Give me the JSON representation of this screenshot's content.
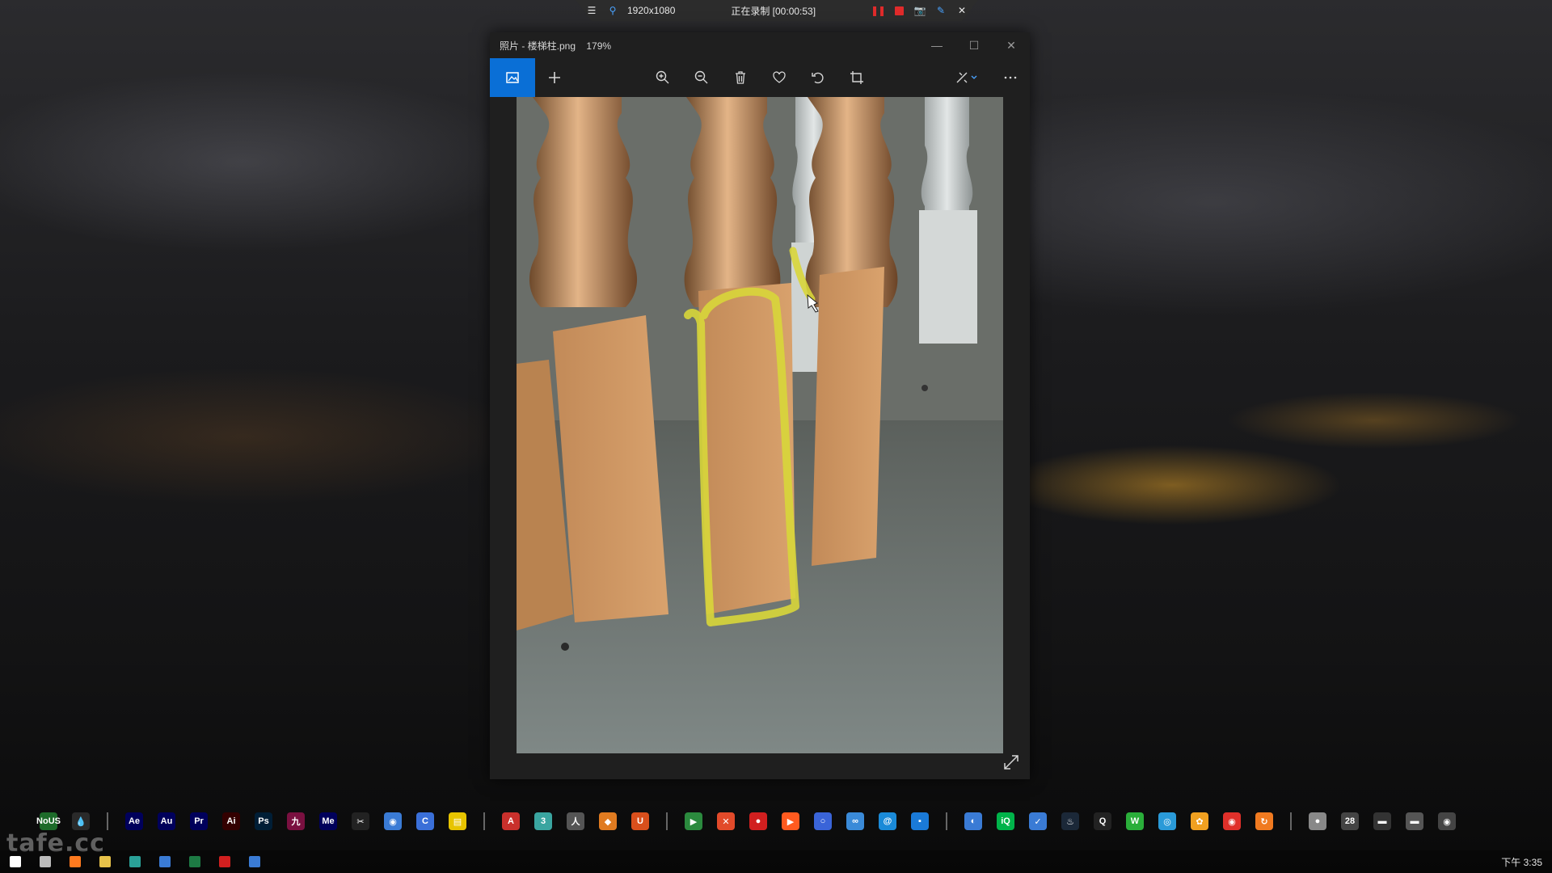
{
  "recording_bar": {
    "resolution": "1920x1080",
    "status": "正在录制 [00:00:53]"
  },
  "photos_window": {
    "title": "照片 - 楼梯柱.png",
    "zoom": "179%"
  },
  "toolbar": {
    "icons": [
      "image-icon",
      "add-icon",
      "zoom-in-icon",
      "zoom-out-icon",
      "delete-icon",
      "favorite-icon",
      "rotate-icon",
      "crop-icon",
      "edit-icon",
      "more-icon"
    ]
  },
  "dock": {
    "groups": [
      [
        {
          "label": "NoUS",
          "color": "#1d6b2a"
        },
        {
          "label": "💧",
          "color": "#2a2a2a"
        }
      ],
      [
        {
          "label": "Ae",
          "color": "#00005b"
        },
        {
          "label": "Au",
          "color": "#00005b"
        },
        {
          "label": "Pr",
          "color": "#00005b"
        },
        {
          "label": "Ai",
          "color": "#330000"
        },
        {
          "label": "Ps",
          "color": "#001e36"
        },
        {
          "label": "九",
          "color": "#7a1040"
        },
        {
          "label": "Me",
          "color": "#00005b"
        },
        {
          "label": "✂",
          "color": "#222222"
        },
        {
          "label": "◉",
          "color": "#3a7bd5"
        },
        {
          "label": "C",
          "color": "#3a6fd8"
        },
        {
          "label": "▤",
          "color": "#e7c400"
        }
      ],
      [
        {
          "label": "A",
          "color": "#c9302c"
        },
        {
          "label": "3",
          "color": "#3aa5a0"
        },
        {
          "label": "人",
          "color": "#555555"
        },
        {
          "label": "◆",
          "color": "#e07b20"
        },
        {
          "label": "U",
          "color": "#d94f1c"
        }
      ],
      [
        {
          "label": "▶",
          "color": "#2b8a3e"
        },
        {
          "label": "✕",
          "color": "#e24a2a"
        },
        {
          "label": "●",
          "color": "#d11f1f"
        },
        {
          "label": "▶",
          "color": "#ff5a1f"
        },
        {
          "label": "○",
          "color": "#3a64d8"
        },
        {
          "label": "∞",
          "color": "#3a8ad8"
        },
        {
          "label": "@",
          "color": "#1a8ad8"
        },
        {
          "label": "▪",
          "color": "#1a7ad8"
        }
      ],
      [
        {
          "label": "◐",
          "color": "#3a7bd5"
        },
        {
          "label": "iQ",
          "color": "#00b34a"
        },
        {
          "label": "✓",
          "color": "#3a7bd5"
        },
        {
          "label": "♨",
          "color": "#1b2838"
        },
        {
          "label": "Q",
          "color": "#222222"
        },
        {
          "label": "W",
          "color": "#2aae3a"
        },
        {
          "label": "◎",
          "color": "#2a9ad8"
        },
        {
          "label": "✿",
          "color": "#f0a020"
        },
        {
          "label": "◉",
          "color": "#e0302a"
        },
        {
          "label": "↻",
          "color": "#f07a20"
        }
      ],
      [
        {
          "label": "●",
          "color": "#888888"
        },
        {
          "label": "28",
          "color": "#444444"
        },
        {
          "label": "▬",
          "color": "#333333"
        },
        {
          "label": "▬",
          "color": "#555555"
        },
        {
          "label": "◉",
          "color": "#444444"
        }
      ]
    ]
  },
  "taskbar": {
    "items": [
      {
        "name": "windows-start-icon",
        "color": "#ffffff"
      },
      {
        "name": "task-view-icon",
        "color": "#bbbbbb"
      },
      {
        "name": "firefox-icon",
        "color": "#ff7a1f"
      },
      {
        "name": "file-explorer-icon",
        "color": "#e7c24a"
      },
      {
        "name": "app-s-icon",
        "color": "#2aa198"
      },
      {
        "name": "app-square-icon",
        "color": "#3a7bd5"
      },
      {
        "name": "excel-icon",
        "color": "#1d7a44"
      },
      {
        "name": "record-icon",
        "color": "#d11f1f"
      },
      {
        "name": "photos-icon",
        "color": "#3a7bd5"
      }
    ],
    "clock": "下午 3:35"
  },
  "watermark": "tafe.cc"
}
